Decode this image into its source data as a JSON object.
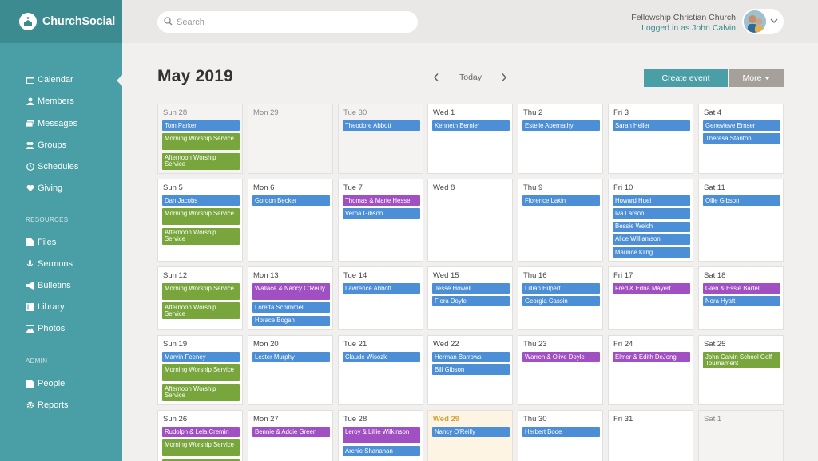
{
  "app": {
    "name": "ChurchSocial"
  },
  "search": {
    "placeholder": "Search"
  },
  "account": {
    "org_name": "Fellowship Christian Church",
    "logged_in": "Logged in as John Calvin"
  },
  "sidebar": {
    "items": [
      "Calendar",
      "Members",
      "Messages",
      "Groups",
      "Schedules",
      "Giving"
    ],
    "resources_label": "RESOURCES",
    "resources": [
      "Files",
      "Sermons",
      "Bulletins",
      "Library",
      "Photos"
    ],
    "admin_label": "ADMIN",
    "admin": [
      "People",
      "Reports"
    ]
  },
  "header": {
    "title": "May 2019",
    "today": "Today",
    "create_event": "Create event",
    "more": "More"
  },
  "colors": {
    "blue": "#4d8fd6",
    "green": "#78a53c",
    "purple": "#a150c4",
    "accent": "#4a9ea5"
  },
  "calendar": {
    "weeks": [
      [
        {
          "label": "Sun 28",
          "state": "dim",
          "events": [
            {
              "t": "Tom Parker",
              "c": "blue"
            },
            {
              "t": "Morning Worship Service",
              "c": "green"
            },
            {
              "t": "Afternoon Worship Service",
              "c": "green"
            }
          ]
        },
        {
          "label": "Mon 29",
          "state": "dim",
          "events": []
        },
        {
          "label": "Tue 30",
          "state": "dim",
          "events": [
            {
              "t": "Theodore Abbott",
              "c": "blue"
            }
          ]
        },
        {
          "label": "Wed 1",
          "state": "",
          "events": [
            {
              "t": "Kenneth Bernier",
              "c": "blue"
            }
          ]
        },
        {
          "label": "Thu 2",
          "state": "",
          "events": [
            {
              "t": "Estelle Abernathy",
              "c": "blue"
            }
          ]
        },
        {
          "label": "Fri 3",
          "state": "",
          "events": [
            {
              "t": "Sarah Heller",
              "c": "blue"
            }
          ]
        },
        {
          "label": "Sat 4",
          "state": "",
          "events": [
            {
              "t": "Genevieve Ernser",
              "c": "blue"
            },
            {
              "t": "Theresa Stanton",
              "c": "blue"
            }
          ]
        }
      ],
      [
        {
          "label": "Sun 5",
          "state": "",
          "events": [
            {
              "t": "Dan Jacobs",
              "c": "blue"
            },
            {
              "t": "Morning Worship Service",
              "c": "green"
            },
            {
              "t": "Afternoon Worship Service",
              "c": "green"
            }
          ]
        },
        {
          "label": "Mon 6",
          "state": "",
          "events": [
            {
              "t": "Gordon Becker",
              "c": "blue"
            }
          ]
        },
        {
          "label": "Tue 7",
          "state": "",
          "events": [
            {
              "t": "Thomas & Marie Hessel",
              "c": "purple"
            },
            {
              "t": "Verna Gibson",
              "c": "blue"
            }
          ]
        },
        {
          "label": "Wed 8",
          "state": "",
          "events": []
        },
        {
          "label": "Thu 9",
          "state": "",
          "events": [
            {
              "t": "Florence Lakin",
              "c": "blue"
            }
          ]
        },
        {
          "label": "Fri 10",
          "state": "",
          "events": [
            {
              "t": "Howard Huel",
              "c": "blue"
            },
            {
              "t": "Iva Larson",
              "c": "blue"
            },
            {
              "t": "Bessie Welch",
              "c": "blue"
            },
            {
              "t": "Alice Williamson",
              "c": "blue"
            },
            {
              "t": "Maurice Kling",
              "c": "blue"
            }
          ]
        },
        {
          "label": "Sat 11",
          "state": "",
          "events": [
            {
              "t": "Ollie Gibson",
              "c": "blue"
            }
          ]
        }
      ],
      [
        {
          "label": "Sun 12",
          "state": "",
          "events": [
            {
              "t": "Morning Worship Service",
              "c": "green"
            },
            {
              "t": "Afternoon Worship Service",
              "c": "green"
            }
          ]
        },
        {
          "label": "Mon 13",
          "state": "",
          "events": [
            {
              "t": "Wallace & Nancy O'Reilly",
              "c": "purple"
            },
            {
              "t": "Loretta Schimmel",
              "c": "blue"
            },
            {
              "t": "Horace Bogan",
              "c": "blue"
            }
          ]
        },
        {
          "label": "Tue 14",
          "state": "",
          "events": [
            {
              "t": "Lawrence Abbott",
              "c": "blue"
            }
          ]
        },
        {
          "label": "Wed 15",
          "state": "",
          "events": [
            {
              "t": "Jesse Howell",
              "c": "blue"
            },
            {
              "t": "Flora Doyle",
              "c": "blue"
            }
          ]
        },
        {
          "label": "Thu 16",
          "state": "",
          "events": [
            {
              "t": "Lillian Hilpert",
              "c": "blue"
            },
            {
              "t": "Georgia Cassin",
              "c": "blue"
            }
          ]
        },
        {
          "label": "Fri 17",
          "state": "",
          "events": [
            {
              "t": "Fred & Edna Mayert",
              "c": "purple"
            }
          ]
        },
        {
          "label": "Sat 18",
          "state": "",
          "events": [
            {
              "t": "Glen & Essie Bartell",
              "c": "purple"
            },
            {
              "t": "Nora Hyatt",
              "c": "blue"
            }
          ]
        }
      ],
      [
        {
          "label": "Sun 19",
          "state": "",
          "events": [
            {
              "t": "Marvin Feeney",
              "c": "blue"
            },
            {
              "t": "Morning Worship Service",
              "c": "green"
            },
            {
              "t": "Afternoon Worship Service",
              "c": "green"
            }
          ]
        },
        {
          "label": "Mon 20",
          "state": "",
          "events": [
            {
              "t": "Lester Murphy",
              "c": "blue"
            }
          ]
        },
        {
          "label": "Tue 21",
          "state": "",
          "events": [
            {
              "t": "Claude Wisozk",
              "c": "blue"
            }
          ]
        },
        {
          "label": "Wed 22",
          "state": "",
          "events": [
            {
              "t": "Herman Barrows",
              "c": "blue"
            },
            {
              "t": "Bill Gibson",
              "c": "blue"
            }
          ]
        },
        {
          "label": "Thu 23",
          "state": "",
          "events": [
            {
              "t": "Warren & Olive Doyle",
              "c": "purple"
            }
          ]
        },
        {
          "label": "Fri 24",
          "state": "",
          "events": [
            {
              "t": "Elmer & Edith DeJong",
              "c": "purple"
            }
          ]
        },
        {
          "label": "Sat 25",
          "state": "",
          "events": [
            {
              "t": "John Calvin School Golf Tournament",
              "c": "green"
            }
          ]
        }
      ],
      [
        {
          "label": "Sun 26",
          "state": "",
          "events": [
            {
              "t": "Rudolph & Lela Cremin",
              "c": "purple"
            },
            {
              "t": "Morning Worship Service",
              "c": "green"
            },
            {
              "t": "",
              "c": "green"
            }
          ]
        },
        {
          "label": "Mon 27",
          "state": "",
          "events": [
            {
              "t": "Bennie & Addie Green",
              "c": "purple"
            }
          ]
        },
        {
          "label": "Tue 28",
          "state": "",
          "events": [
            {
              "t": "Leroy & Lillie Wilkinson",
              "c": "purple"
            },
            {
              "t": "Archie Shanahan",
              "c": "blue"
            }
          ]
        },
        {
          "label": "Wed 29",
          "state": "today",
          "events": [
            {
              "t": "Nancy O'Reilly",
              "c": "blue"
            }
          ]
        },
        {
          "label": "Thu 30",
          "state": "",
          "events": [
            {
              "t": "Herbert Bode",
              "c": "blue"
            }
          ]
        },
        {
          "label": "Fri 31",
          "state": "",
          "events": []
        },
        {
          "label": "Sat 1",
          "state": "dim",
          "events": []
        }
      ]
    ]
  }
}
